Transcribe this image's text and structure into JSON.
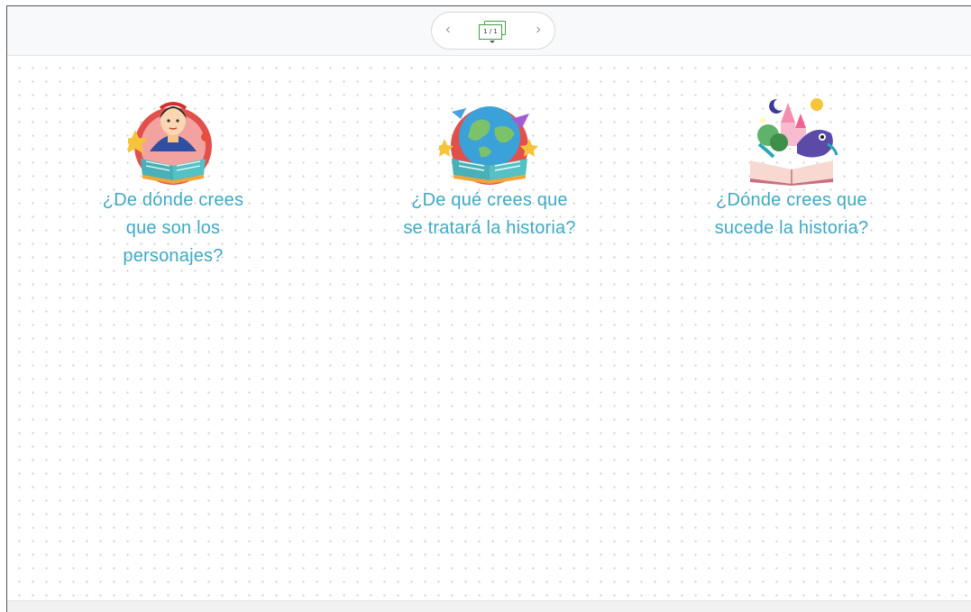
{
  "toolbar": {
    "prev_label": "‹",
    "next_label": "›",
    "page_indicator": "1 / 1"
  },
  "cards": [
    {
      "illustration": "princess-book-icon",
      "question": "¿De dónde crees que son los personajes?"
    },
    {
      "illustration": "globe-book-icon",
      "question": "¿De qué crees que se tratará la historia?"
    },
    {
      "illustration": "fairytale-book-icon",
      "question": "¿Dónde crees que sucede la historia?"
    }
  ],
  "colors": {
    "question_text": "#3fa9c3",
    "pager_accent": "#43a047",
    "dot_grid": "#d3d3d3"
  }
}
